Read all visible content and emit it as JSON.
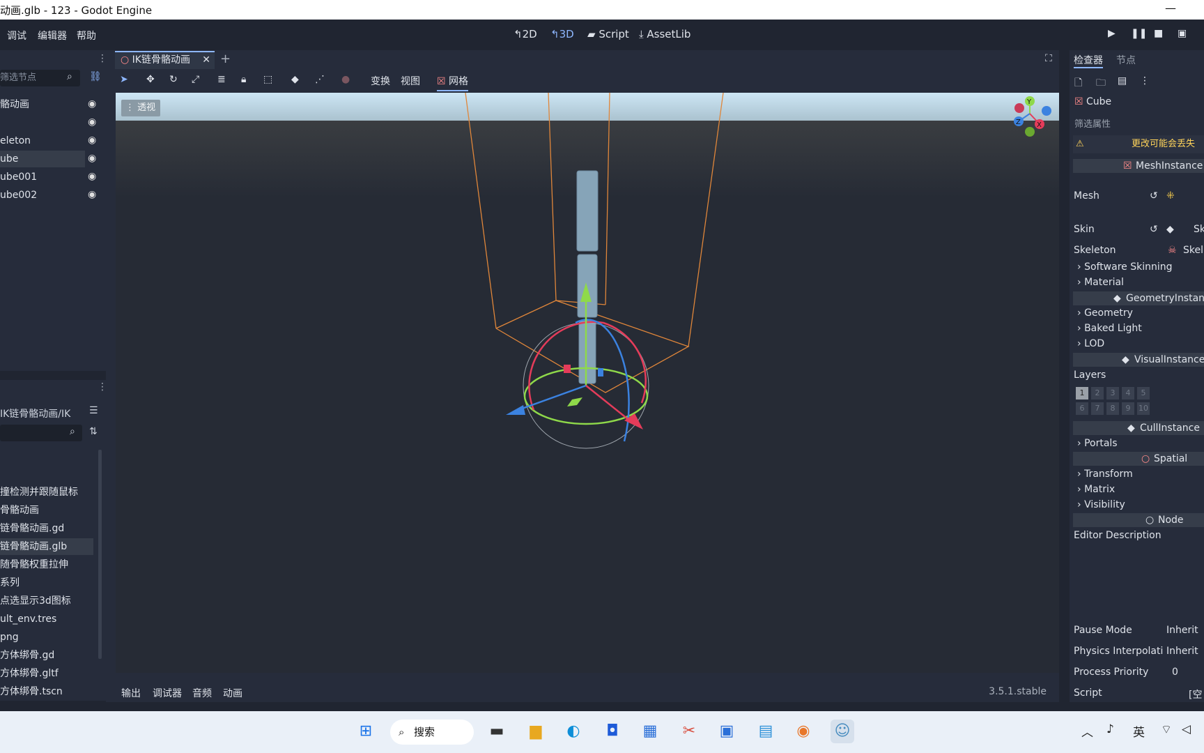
{
  "window": {
    "title": "动画.glb - 123 - Godot Engine"
  },
  "menu": [
    "调试",
    "编辑器",
    "帮助"
  ],
  "workspaces": [
    {
      "label": "2D",
      "icon": "2d-icon"
    },
    {
      "label": "3D",
      "icon": "3d-icon"
    },
    {
      "label": "Script",
      "icon": "script-icon"
    },
    {
      "label": "AssetLib",
      "icon": "assetlib-icon"
    }
  ],
  "scene_dock": {
    "filter_placeholder": "筛选节点",
    "nodes": [
      {
        "label": "骼动画"
      },
      {
        "label": ""
      },
      {
        "label": "eleton"
      },
      {
        "label": "ube",
        "selected": true
      },
      {
        "label": "ube001"
      },
      {
        "label": "ube002"
      }
    ]
  },
  "filesystem": {
    "path": "IK链骨骼动画/IK",
    "files": [
      {
        "label": "撞检测并跟随鼠标"
      },
      {
        "label": "骨骼动画"
      },
      {
        "label": "链骨骼动画.gd"
      },
      {
        "label": "链骨骼动画.glb",
        "selected": true
      },
      {
        "label": "随骨骼权重拉伸"
      },
      {
        "label": "系列"
      },
      {
        "label": "点选显示3d图标"
      },
      {
        "label": "ult_env.tres"
      },
      {
        "label": "png"
      },
      {
        "label": "方体绑骨.gd"
      },
      {
        "label": "方体绑骨.gltf"
      },
      {
        "label": "方体绑骨.tscn"
      }
    ]
  },
  "editor": {
    "tab_label": "IK链骨骼动画",
    "toolbar_menus": {
      "transform": "变换",
      "view": "视图",
      "mesh": "网格"
    },
    "viewport_label": "透视",
    "gizmo_axes": {
      "y": "Y",
      "x": "X",
      "z": "Z"
    }
  },
  "bottom_panel": {
    "tabs": [
      "输出",
      "调试器",
      "音频",
      "动画"
    ],
    "version": "3.5.1.stable"
  },
  "inspector": {
    "tabs": {
      "inspector": "检查器",
      "node": "节点"
    },
    "object": "Cube",
    "filter_placeholder": "筛选属性",
    "warning": "更改可能会丢失",
    "sections": {
      "mesh_instance": "MeshInstance",
      "geometry_instance": "GeometryInstance",
      "visual_instance": "VisualInstance",
      "cull_instance": "CullInstance",
      "spatial": "Spatial",
      "node": "Node"
    },
    "props": {
      "mesh": "Mesh",
      "skin": "Skin",
      "skin_value": "Sk",
      "skeleton": "Skeleton",
      "skeleton_value": "Skel",
      "software_skinning": "Software Skinning",
      "material": "Material",
      "geometry": "Geometry",
      "baked_light": "Baked Light",
      "lod": "LOD",
      "layers": "Layers",
      "portals": "Portals",
      "transform": "Transform",
      "matrix": "Matrix",
      "visibility": "Visibility",
      "editor_description": "Editor Description",
      "pause_mode": "Pause Mode",
      "pause_mode_value": "Inherit",
      "physics_interp": "Physics Interpolati",
      "physics_interp_value": "Inherit",
      "process_priority": "Process Priority",
      "process_priority_value": "0",
      "script": "Script",
      "script_value": "[空"
    },
    "layer_numbers": [
      "1",
      "2",
      "3",
      "4",
      "5",
      "6",
      "7",
      "8",
      "9",
      "10"
    ]
  },
  "taskbar": {
    "search_label": "搜索",
    "lang": "英"
  },
  "colors": {
    "accent": "#8eb7ff",
    "panel": "#262c3b",
    "bg": "#202531",
    "warning": "#ffd45a"
  }
}
